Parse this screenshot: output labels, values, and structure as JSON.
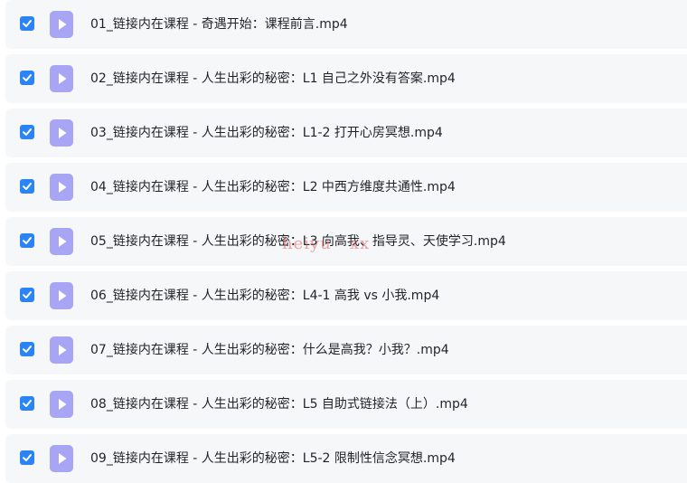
{
  "files": [
    {
      "name": "01_链接内在课程 - 奇遇开始：课程前言.mp4",
      "checked": true
    },
    {
      "name": "02_链接内在课程 - 人生出彩的秘密：L1 自己之外没有答案.mp4",
      "checked": true
    },
    {
      "name": "03_链接内在课程 - 人生出彩的秘密：L1-2 打开心房冥想.mp4",
      "checked": true
    },
    {
      "name": "04_链接内在课程 - 人生出彩的秘密：L2 中西方维度共通性.mp4",
      "checked": true
    },
    {
      "name": "05_链接内在课程 - 人生出彩的秘密：L3 向高我、指导灵、天使学习.mp4",
      "checked": true
    },
    {
      "name": "06_链接内在课程 - 人生出彩的秘密：L4-1 高我 vs 小我.mp4",
      "checked": true
    },
    {
      "name": "07_链接内在课程 - 人生出彩的秘密：什么是高我？小我？.mp4",
      "checked": true
    },
    {
      "name": "08_链接内在课程 - 人生出彩的秘密：L5 自助式链接法（上）.mp4",
      "checked": true
    },
    {
      "name": "09_链接内在课程 - 人生出彩的秘密：L5-2 限制性信念冥想.mp4",
      "checked": true
    }
  ],
  "watermark": "heiyu · xx",
  "colors": {
    "checkbox": "#2b84f6",
    "file_icon": "#a8a6f4",
    "row_bg": "#f6f7f9"
  },
  "icons": {
    "checkbox": "check-icon",
    "file": "video-file-icon"
  }
}
